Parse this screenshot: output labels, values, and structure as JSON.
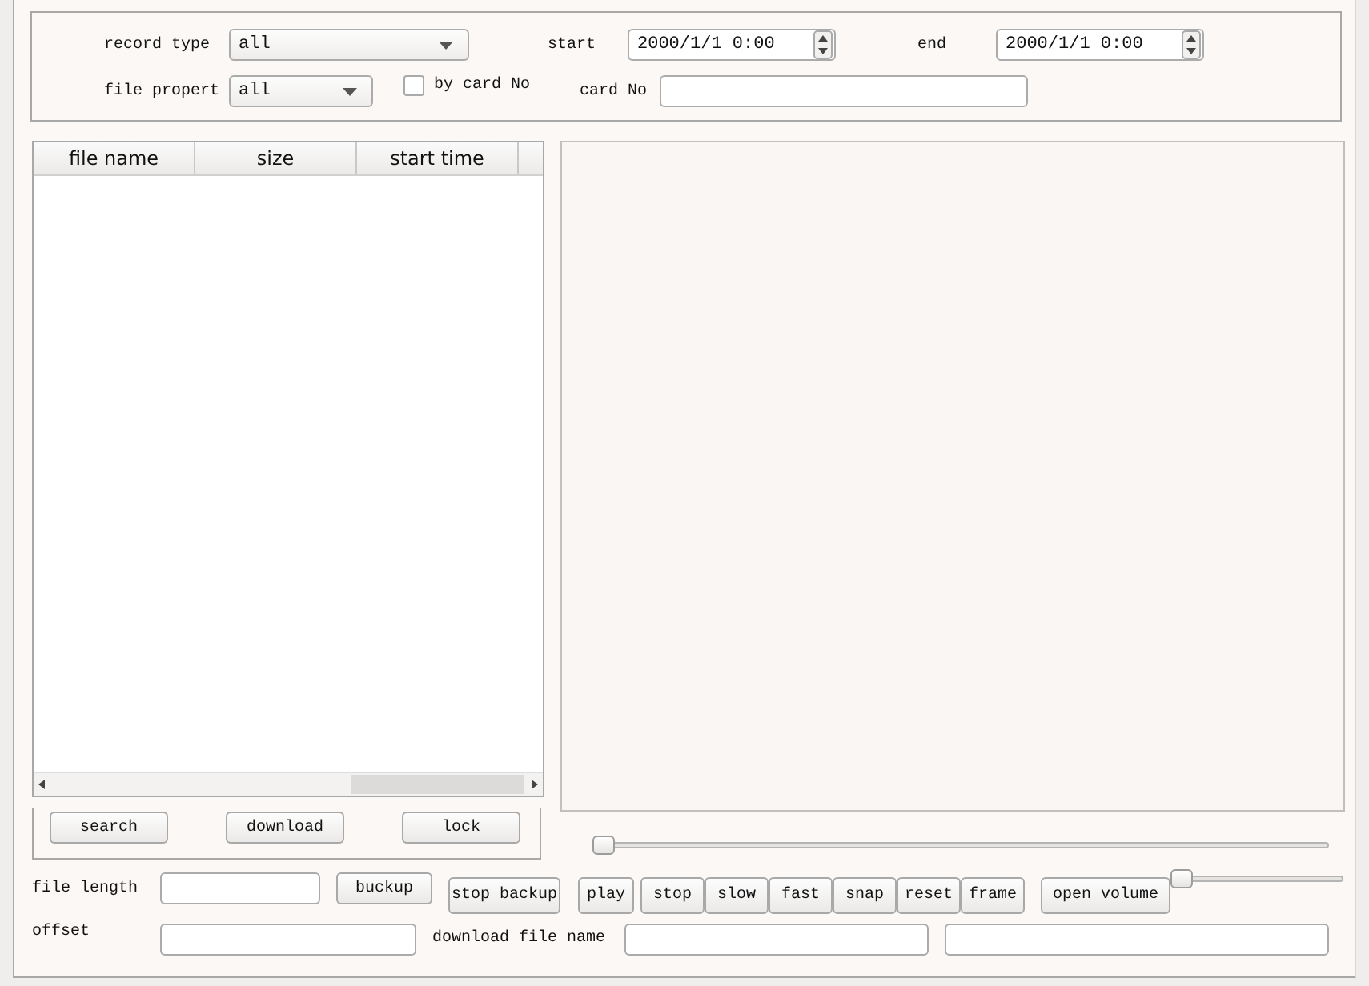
{
  "filters": {
    "record_type": {
      "label": "record type",
      "value": "all"
    },
    "start": {
      "label": "start",
      "value": "2000/1/1 0:00"
    },
    "end": {
      "label": "end",
      "value": "2000/1/1 0:00"
    },
    "file_property": {
      "label": "file propert",
      "value": "all"
    },
    "by_card_no": {
      "label": "by card No",
      "checked": false
    },
    "card_no": {
      "label": "card No"
    }
  },
  "table": {
    "columns": [
      "file name",
      "size",
      "start time"
    ]
  },
  "actions": [
    "search",
    "download",
    "lock"
  ],
  "playback": {
    "level": 0
  },
  "file_length": {
    "label": "file length"
  },
  "backup_buttons": [
    "buckup",
    "stop backup"
  ],
  "controls": [
    "play",
    "stop",
    "slow",
    "fast",
    "snap",
    "reset",
    "frame"
  ],
  "volume": {
    "button": "open volume",
    "level": 0
  },
  "offset": {
    "label": "offset"
  },
  "download_file_name": {
    "label": "download file name"
  }
}
